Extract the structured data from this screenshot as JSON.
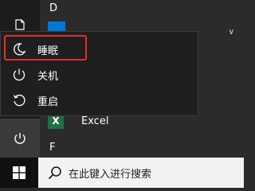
{
  "app_list": {
    "section_d": "D",
    "section_f": "F",
    "excel_label": "Excel",
    "excel_icon_letter": "X"
  },
  "power_menu": {
    "items": [
      {
        "label": "睡眠",
        "icon": "moon-icon"
      },
      {
        "label": "关机",
        "icon": "power-icon"
      },
      {
        "label": "重启",
        "icon": "restart-icon"
      }
    ],
    "highlight_color": "#e2302a"
  },
  "taskbar": {
    "search_placeholder": "在此键入进行搜索"
  }
}
